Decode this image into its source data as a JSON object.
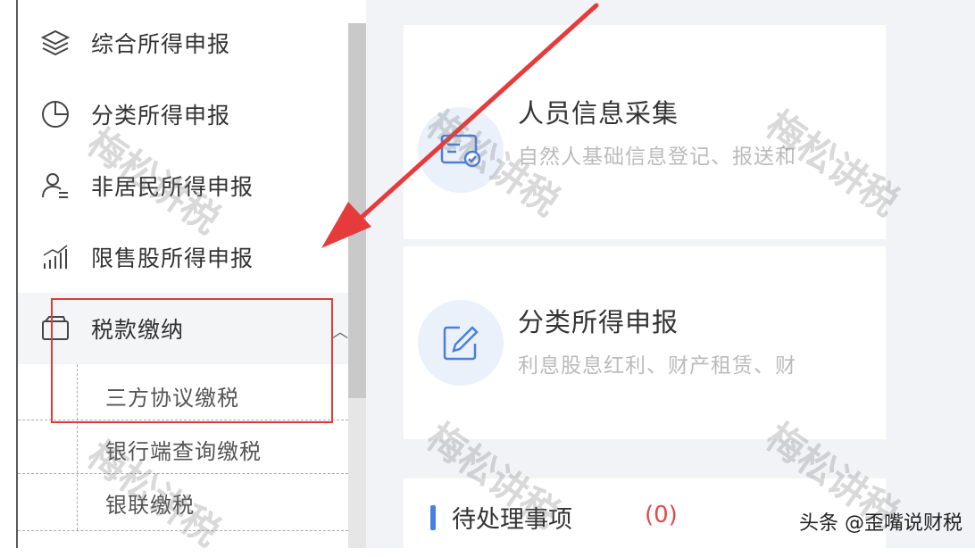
{
  "sidebar": {
    "items": [
      {
        "label": "综合所得申报",
        "icon": "layers-icon"
      },
      {
        "label": "分类所得申报",
        "icon": "pie-chart-icon"
      },
      {
        "label": "非居民所得申报",
        "icon": "user-icon"
      },
      {
        "label": "限售股所得申报",
        "icon": "bar-chart-icon"
      },
      {
        "label": "税款缴纳",
        "icon": "wallet-icon",
        "expanded": true
      }
    ],
    "submenu": [
      {
        "label": "三方协议缴税"
      },
      {
        "label": "银行端查询缴税"
      },
      {
        "label": "银联缴税"
      }
    ]
  },
  "main": {
    "cards": [
      {
        "title": "人员信息采集",
        "desc": "自然人基础信息登记、报送和",
        "icon": "id-card-icon"
      },
      {
        "title": "分类所得申报",
        "desc": "利息股息红利、财产租赁、财",
        "icon": "edit-icon"
      }
    ],
    "pending": {
      "title": "待处理事项",
      "count": "(0)"
    }
  },
  "watermark": {
    "text": "梅松讲税"
  },
  "credit": {
    "text": "头条 @歪嘴说财税"
  },
  "colors": {
    "annotation": "#e03a3a",
    "accent": "#4a7fe0"
  }
}
